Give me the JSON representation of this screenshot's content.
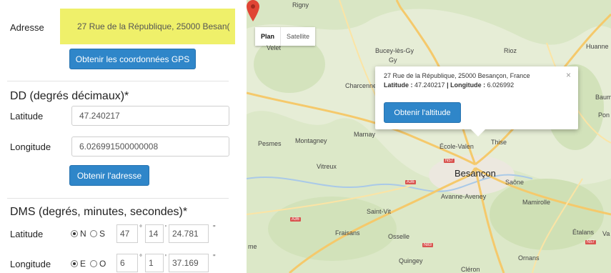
{
  "form": {
    "address_label": "Adresse",
    "address_value": "27 Rue de la République, 25000 Besan(",
    "get_gps_button": "Obtenir les coordonnées GPS",
    "dd_title": "DD (degrés décimaux)*",
    "dd_latitude_label": "Latitude",
    "dd_latitude_value": "47.240217",
    "dd_longitude_label": "Longitude",
    "dd_longitude_value": "6.026991500000008",
    "get_address_button": "Obtenir l'adresse",
    "dms_title": "DMS (degrés, minutes, secondes)*",
    "dms_latitude_label": "Latitude",
    "dms_latitude_dir": {
      "n": "N",
      "s": "S",
      "selected": "N"
    },
    "dms_latitude_deg": "47",
    "dms_latitude_min": "14",
    "dms_latitude_sec": "24.781",
    "dms_longitude_label": "Longitude",
    "dms_longitude_dir": {
      "e": "E",
      "o": "O",
      "selected": "E"
    },
    "dms_longitude_deg": "6",
    "dms_longitude_min": "1",
    "dms_longitude_sec": "37.169",
    "unit_deg": "°",
    "unit_min": "'",
    "unit_sec": "\""
  },
  "map": {
    "type_plan": "Plan",
    "type_satellite": "Satellite",
    "popup_address": "27 Rue de la République, 25000 Besançon, France",
    "popup_lat_label": "Latitude :",
    "popup_lat_value": "47.240217",
    "popup_sep": "|",
    "popup_lon_label": "Longitude :",
    "popup_lon_value": "6.026992",
    "popup_close": "×",
    "popup_button": "Obtenir l'altitude",
    "towns": {
      "rigny": "Rigny",
      "velet": "Velet",
      "bucey": "Bucey-lès-Gy",
      "gy": "Gy",
      "rioz": "Rioz",
      "huanne": "Huanne",
      "charcenne": "Charcenne",
      "baume": "Baum",
      "pon": "Pon",
      "pesmes": "Pesmes",
      "montagney": "Montagney",
      "marnay": "Marnay",
      "ecole": "École-Valen",
      "thise": "Thise",
      "vitreux": "Vitreux",
      "besancon": "Besançon",
      "saone": "Saône",
      "avanne": "Avanne-Aveney",
      "mamirolle": "Mamirolle",
      "saint_vit": "Saint-Vit",
      "fraisans": "Fraisans",
      "osselle": "Osselle",
      "etalans": "Étalans",
      "va": "Va",
      "me": "me",
      "quingey": "Quingey",
      "ornans": "Ornans",
      "cleron": "Cléron"
    },
    "roads": {
      "n57_top": "N57",
      "a36_mid": "A36",
      "a36_left": "A36",
      "n83": "N83",
      "n57_right": "N57"
    }
  }
}
